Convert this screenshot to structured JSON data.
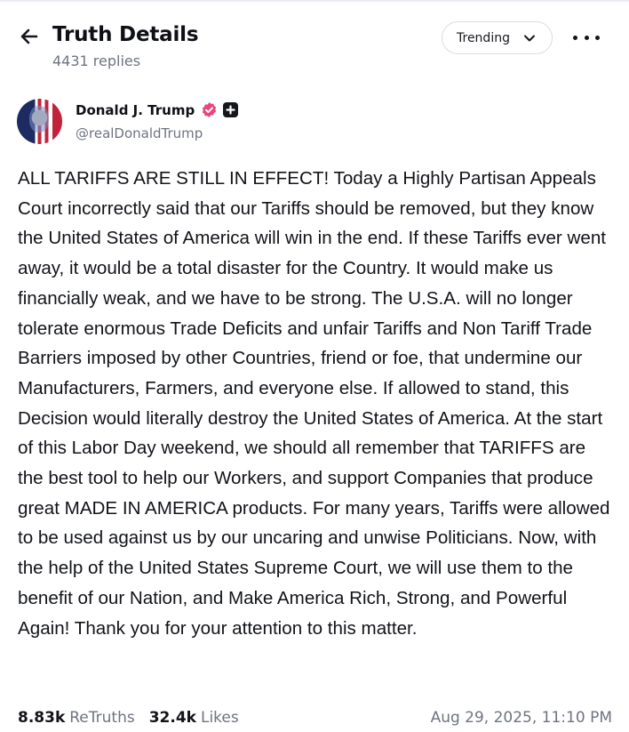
{
  "header": {
    "title": "Truth Details",
    "replies": "4431 replies",
    "sort_label": "Trending"
  },
  "author": {
    "display_name": "Donald J. Trump",
    "handle": "@realDonaldTrump"
  },
  "post": {
    "text": "ALL TARIFFS ARE STILL IN EFFECT! Today a Highly Partisan Appeals Court incorrectly said that our Tariffs should be removed, but they know the United States of America will win in the end. If these Tariffs ever went away, it would be a total disaster for the Country. It would make us financially weak, and we have to be strong. The U.S.A. will no longer tolerate enormous Trade Deficits and unfair Tariffs and Non Tariff Trade Barriers imposed by other Countries, friend or foe, that undermine our Manufacturers, Farmers, and everyone else. If allowed to stand, this Decision would literally destroy the United States of America. At the start of this Labor Day weekend, we should all remember that TARIFFS are the best tool to help our Workers, and support Companies that produce great MADE IN AMERICA products. For many years, Tariffs were allowed to be used against us by our uncaring and unwise Politicians. Now, with the help of the United States Supreme Court, we will use them to the benefit of our Nation, and Make America Rich, Strong, and Powerful Again! Thank you for your attention to this matter."
  },
  "stats": {
    "retruths_count": "8.83k",
    "retruths_label": "ReTruths",
    "likes_count": "32.4k",
    "likes_label": "Likes",
    "timestamp": "Aug 29, 2025, 11:10 PM"
  },
  "icons": {
    "back": "arrow-left-icon",
    "sort_chevron": "chevron-down-icon",
    "more": "more-horizontal-icon",
    "verified": "verified-badge-icon",
    "plus": "plus-badge-icon"
  },
  "colors": {
    "verified_badge": "#e8467c",
    "secondary_text": "#6f7480",
    "primary_text": "#121419"
  }
}
